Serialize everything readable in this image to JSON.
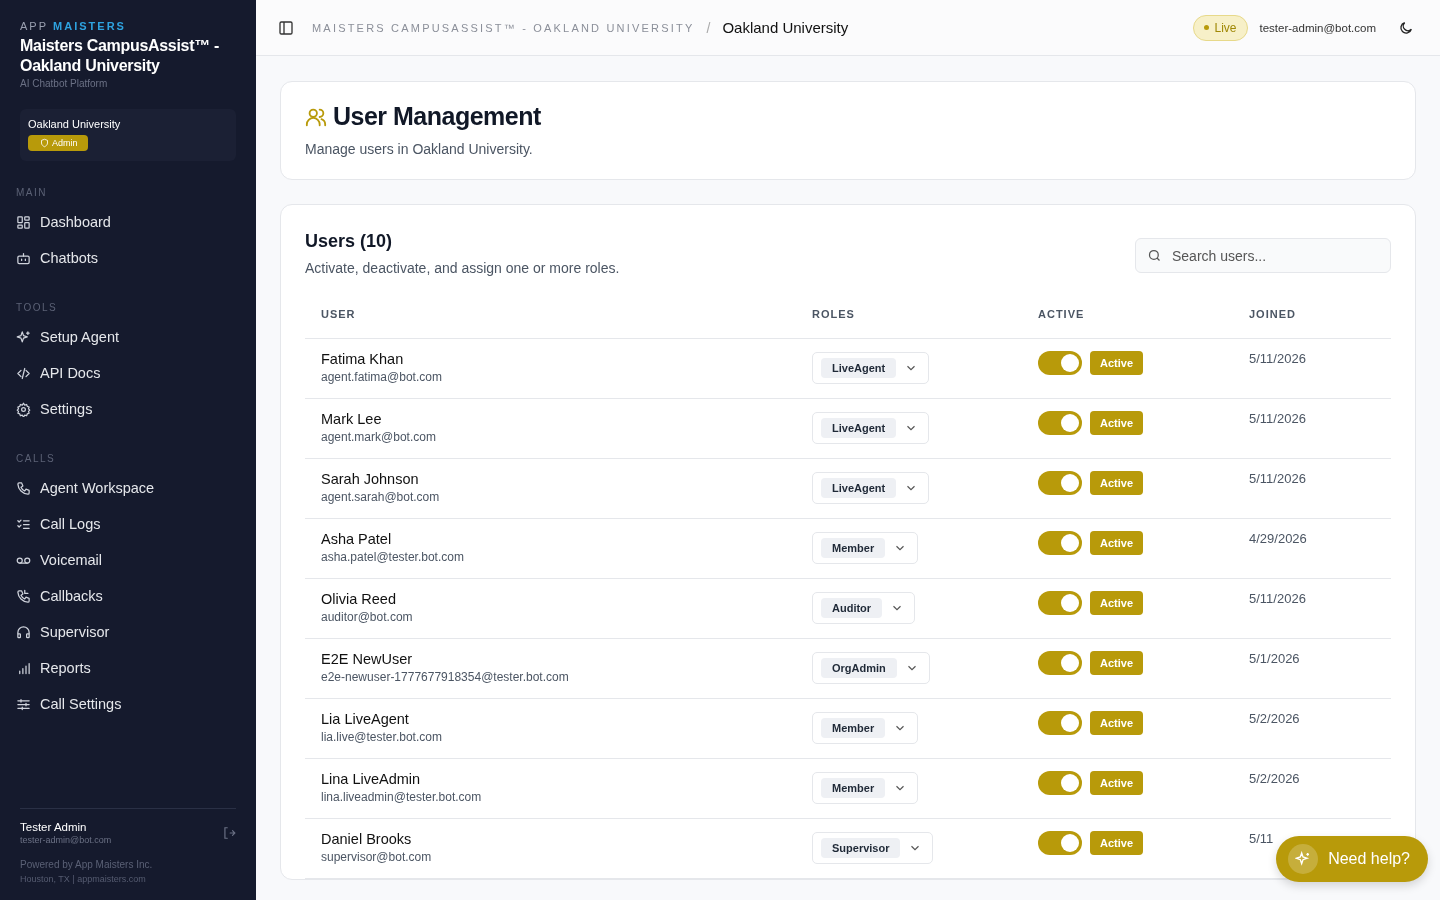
{
  "sidebar": {
    "brand_prefix": "APP",
    "brand_name": "MAISTERS",
    "title": "Maisters CampusAssist™ - Oakland University",
    "subtitle": "AI Chatbot Platform",
    "org": {
      "name": "Oakland University",
      "role": "Admin"
    },
    "sections": [
      {
        "heading": "MAIN",
        "items": [
          {
            "label": "Dashboard"
          },
          {
            "label": "Chatbots"
          }
        ]
      },
      {
        "heading": "TOOLS",
        "items": [
          {
            "label": "Setup Agent"
          },
          {
            "label": "API Docs"
          },
          {
            "label": "Settings"
          }
        ]
      },
      {
        "heading": "CALLS",
        "items": [
          {
            "label": "Agent Workspace"
          },
          {
            "label": "Call Logs"
          },
          {
            "label": "Voicemail"
          },
          {
            "label": "Callbacks"
          },
          {
            "label": "Supervisor"
          },
          {
            "label": "Reports"
          },
          {
            "label": "Call Settings"
          }
        ]
      }
    ],
    "user": {
      "name": "Tester Admin",
      "email": "tester-admin@bot.com"
    },
    "footer": [
      "Powered by App Maisters Inc.",
      "Houston, TX | appmaisters.com"
    ]
  },
  "header": {
    "breadcrumb": [
      "MAISTERS CAMPUSASSIST™ - OAKLAND UNIVERSITY",
      "/",
      "Oakland University"
    ],
    "status": "Live",
    "email": "tester-admin@bot.com"
  },
  "page": {
    "title": "User Management",
    "subtitle": "Manage users in Oakland University."
  },
  "users": {
    "title": "Users (10)",
    "subtitle": "Activate, deactivate, and assign one or more roles.",
    "search": {
      "placeholder": "Search users..."
    },
    "columns": [
      "USER",
      "ROLES",
      "ACTIVE",
      "JOINED"
    ],
    "rows": [
      {
        "name": "Fatima Khan",
        "email": "agent.fatima@bot.com",
        "role": "LiveAgent",
        "on": true,
        "status": "Active",
        "joined": "5/11/2026"
      },
      {
        "name": "Mark Lee",
        "email": "agent.mark@bot.com",
        "role": "LiveAgent",
        "on": true,
        "status": "Active",
        "joined": "5/11/2026"
      },
      {
        "name": "Sarah Johnson",
        "email": "agent.sarah@bot.com",
        "role": "LiveAgent",
        "on": true,
        "status": "Active",
        "joined": "5/11/2026"
      },
      {
        "name": "Asha Patel",
        "email": "asha.patel@tester.bot.com",
        "role": "Member",
        "on": true,
        "status": "Active",
        "joined": "4/29/2026"
      },
      {
        "name": "Olivia Reed",
        "email": "auditor@bot.com",
        "role": "Auditor",
        "on": true,
        "status": "Active",
        "joined": "5/11/2026"
      },
      {
        "name": "E2E NewUser",
        "email": "e2e-newuser-1777677918354@tester.bot.com",
        "role": "OrgAdmin",
        "on": true,
        "status": "Active",
        "joined": "5/1/2026"
      },
      {
        "name": "Lia LiveAgent",
        "email": "lia.live@tester.bot.com",
        "role": "Member",
        "on": true,
        "status": "Active",
        "joined": "5/2/2026"
      },
      {
        "name": "Lina LiveAdmin",
        "email": "lina.liveadmin@tester.bot.com",
        "role": "Member",
        "on": true,
        "status": "Active",
        "joined": "5/2/2026"
      },
      {
        "name": "Daniel Brooks",
        "email": "supervisor@bot.com",
        "role": "Supervisor",
        "on": true,
        "status": "Active",
        "joined": "5/11"
      }
    ]
  },
  "help_button": "Need help?"
}
